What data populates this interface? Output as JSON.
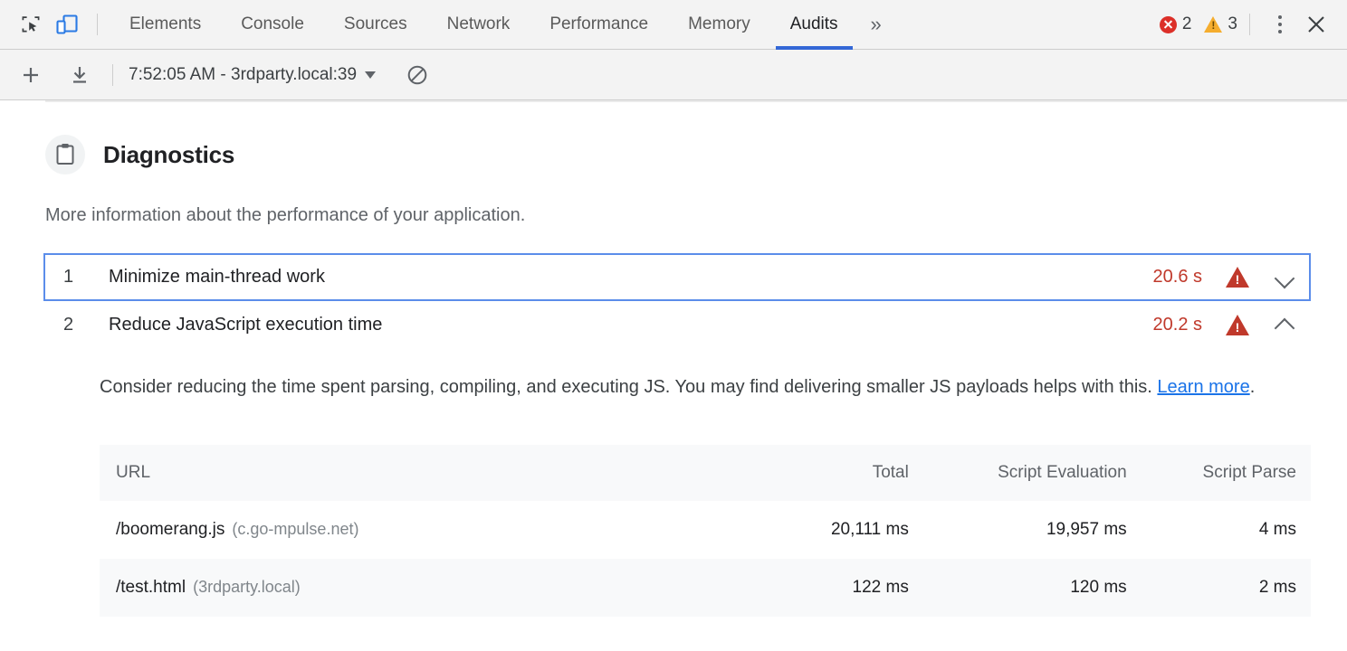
{
  "devtools": {
    "icons": {
      "inspect": "inspect-cursor-icon",
      "device": "device-toolbar-icon",
      "more_tabs": "»",
      "close": "✕"
    },
    "tabs": [
      {
        "label": "Elements",
        "selected": false
      },
      {
        "label": "Console",
        "selected": false
      },
      {
        "label": "Sources",
        "selected": false
      },
      {
        "label": "Network",
        "selected": false
      },
      {
        "label": "Performance",
        "selected": false
      },
      {
        "label": "Memory",
        "selected": false
      },
      {
        "label": "Audits",
        "selected": true
      }
    ],
    "issues": {
      "error_count": "2",
      "warning_count": "3",
      "error_color": "#dc2f28",
      "warning_color": "#f5ad2e"
    },
    "accent_color": "#3367d6"
  },
  "audits_toolbar": {
    "add_label": "+",
    "download_label": "download-icon",
    "report_label": "7:52:05 AM - 3rdparty.local:39",
    "clear_label": "clear-icon"
  },
  "section": {
    "icon": "clipboard-icon",
    "title": "Diagnostics",
    "description": "More information about the performance of your application."
  },
  "audits": [
    {
      "index": "1",
      "title": "Minimize main-thread work",
      "score": "20.6 s",
      "severity_icon": "warning-triangle-icon",
      "expanded": false,
      "focused": true,
      "chevron": "chevron-down-icon"
    },
    {
      "index": "2",
      "title": "Reduce JavaScript execution time",
      "score": "20.2 s",
      "severity_icon": "warning-triangle-icon",
      "expanded": true,
      "focused": false,
      "chevron": "chevron-up-icon"
    }
  ],
  "detail": {
    "text_before_link": "Consider reducing the time spent parsing, compiling, and executing JS. You may find delivering smaller JS payloads helps with this. ",
    "link_label": "Learn more",
    "text_after_link": ".",
    "table": {
      "columns": [
        "URL",
        "Total",
        "Script Evaluation",
        "Script Parse"
      ],
      "rows": [
        {
          "url_path": "/boomerang.js",
          "url_host": "(c.go-mpulse.net)",
          "total": "20,111 ms",
          "script_evaluation": "19,957 ms",
          "script_parse": "4 ms"
        },
        {
          "url_path": "/test.html",
          "url_host": "(3rdparty.local)",
          "total": "122 ms",
          "script_evaluation": "120 ms",
          "script_parse": "2 ms"
        }
      ]
    }
  },
  "colors": {
    "severity_red": "#c0392b",
    "link_blue": "#1a73e8",
    "focus_blue": "#5b8dea"
  }
}
